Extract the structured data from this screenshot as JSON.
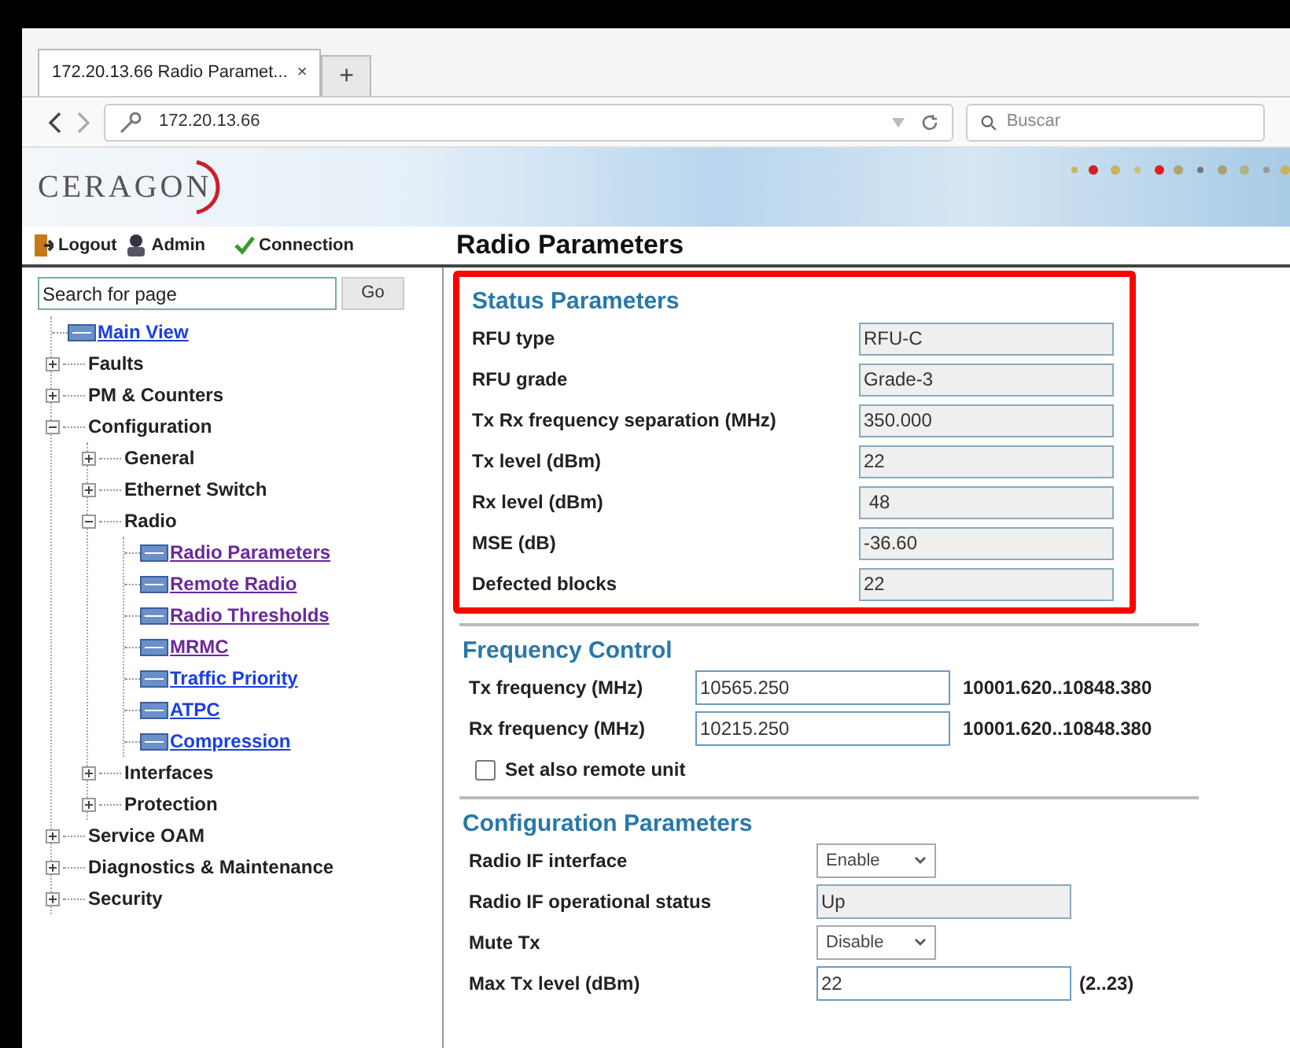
{
  "browser": {
    "tab": {
      "title": "172.20.13.66  Radio Paramet...",
      "close": "×",
      "selected": true
    },
    "new_tab": "+",
    "url": "172.20.13.66",
    "search": {
      "placeholder": "Buscar"
    }
  },
  "banner": {
    "logo": "CERAGON"
  },
  "toolbar": {
    "items": [
      {
        "kind": "logout",
        "label": "Logout"
      },
      {
        "kind": "admin",
        "label": "Admin"
      },
      {
        "kind": "connection",
        "label": "Connection"
      }
    ],
    "page_title": "Radio Parameters"
  },
  "sidebar": {
    "search": {
      "placeholder": "Search for page"
    },
    "go": "Go",
    "tree": [
      {
        "kind": "link",
        "label": "Main View",
        "visited": false
      },
      {
        "kind": "folder",
        "label": "Faults",
        "expanded": false
      },
      {
        "kind": "folder",
        "label": "PM & Counters",
        "expanded": false
      },
      {
        "kind": "folder",
        "label": "Configuration",
        "expanded": true,
        "children": [
          {
            "kind": "folder",
            "label": "General",
            "expanded": false
          },
          {
            "kind": "folder",
            "label": "Ethernet Switch",
            "expanded": false
          },
          {
            "kind": "folder",
            "label": "Radio",
            "expanded": true,
            "children": [
              {
                "kind": "link",
                "label": "Radio Parameters",
                "visited": true
              },
              {
                "kind": "link",
                "label": "Remote Radio",
                "visited": true
              },
              {
                "kind": "link",
                "label": "Radio Thresholds",
                "visited": true
              },
              {
                "kind": "link",
                "label": "MRMC",
                "visited": true
              },
              {
                "kind": "link",
                "label": "Traffic Priority",
                "visited": false
              },
              {
                "kind": "link",
                "label": "ATPC",
                "visited": false
              },
              {
                "kind": "link",
                "label": "Compression",
                "visited": false
              }
            ]
          },
          {
            "kind": "folder",
            "label": "Interfaces",
            "expanded": false
          },
          {
            "kind": "folder",
            "label": "Protection",
            "expanded": false
          }
        ]
      },
      {
        "kind": "folder",
        "label": "Service OAM",
        "expanded": false
      },
      {
        "kind": "folder",
        "label": "Diagnostics & Maintenance",
        "expanded": false
      },
      {
        "kind": "folder",
        "label": "Security",
        "expanded": false
      }
    ]
  },
  "status": {
    "title": "Status Parameters",
    "highlighted": true,
    "rows": [
      {
        "label": "RFU type",
        "value": "RFU-C"
      },
      {
        "label": "RFU grade",
        "value": "Grade-3"
      },
      {
        "label": "Tx Rx frequency separation (MHz)",
        "value": "350.000"
      },
      {
        "label": "Tx level (dBm)",
        "value": "22"
      },
      {
        "label": "Rx level (dBm)",
        "value": " 48"
      },
      {
        "label": "MSE (dB)",
        "value": "-36.60"
      },
      {
        "label": "Defected blocks",
        "value": "22"
      }
    ]
  },
  "frequency": {
    "title": "Frequency Control",
    "rows": [
      {
        "label": "Tx frequency (MHz)",
        "value": "10565.250",
        "range": "10001.620..10848.380"
      },
      {
        "label": "Rx frequency (MHz)",
        "value": "10215.250",
        "range": "10001.620..10848.380"
      }
    ],
    "remote": {
      "label": "Set also remote unit",
      "checked": false
    }
  },
  "config": {
    "title": "Configuration Parameters",
    "rows": [
      {
        "kind": "select",
        "label": "Radio IF interface",
        "value": "Enable"
      },
      {
        "kind": "readonly",
        "label": "Radio IF operational status",
        "value": "Up"
      },
      {
        "kind": "select",
        "label": "Mute Tx",
        "value": "Disable"
      },
      {
        "kind": "input",
        "label": "Max Tx level (dBm)",
        "value": "22",
        "range": "(2..23)"
      }
    ]
  }
}
